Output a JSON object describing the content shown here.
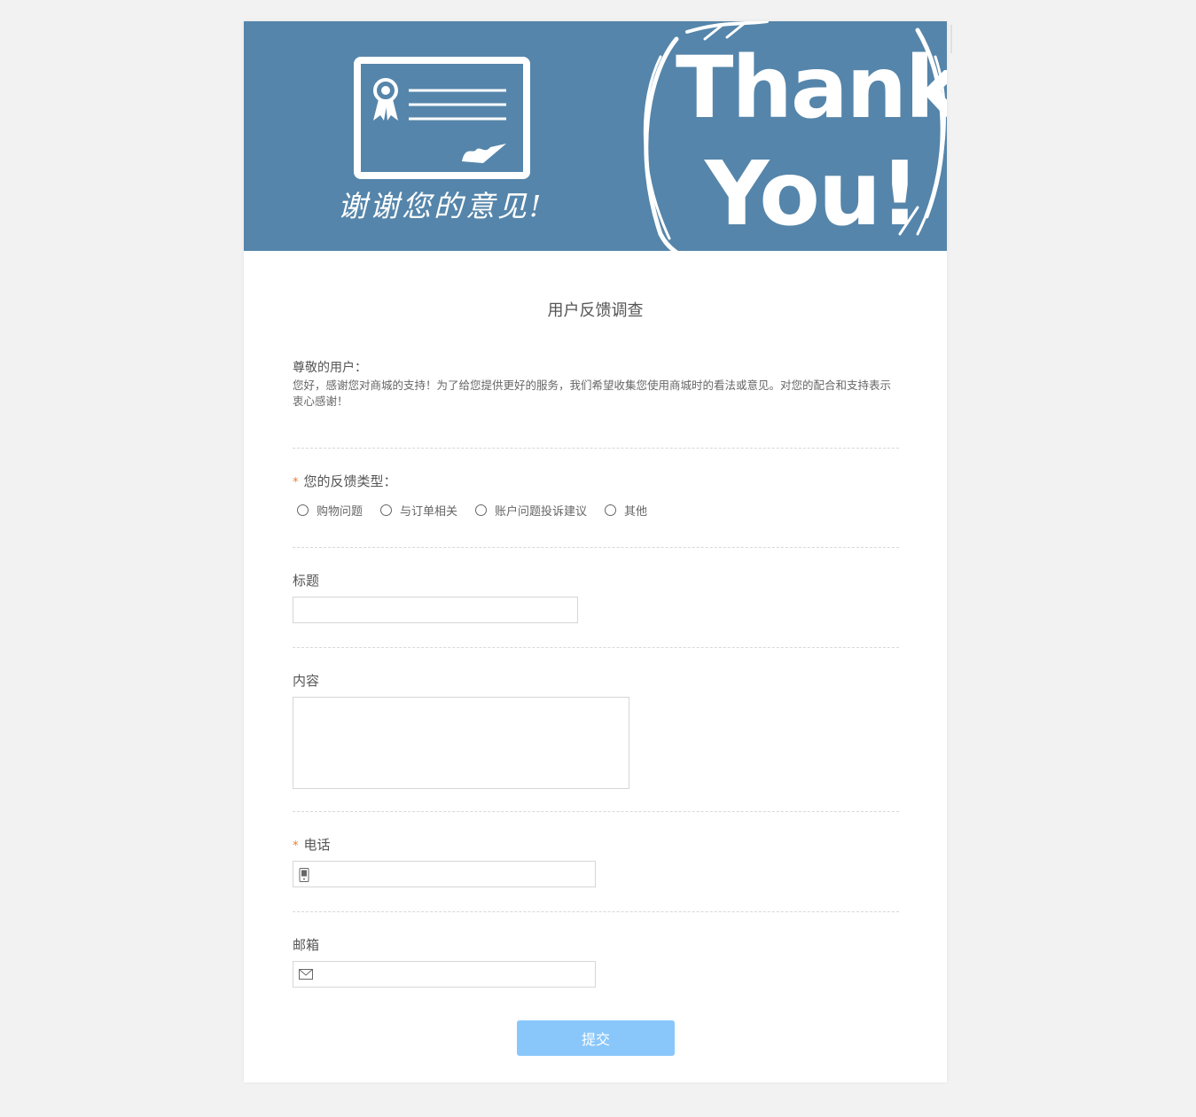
{
  "banner": {
    "caption": "谢谢您的意见!",
    "thank_line1": "Thank",
    "thank_line2": "You!"
  },
  "form": {
    "title": "用户反馈调查",
    "greeting": "尊敬的用户：",
    "intro": "您好，感谢您对商城的支持！为了给您提供更好的服务，我们希望收集您使用商城时的看法或意见。对您的配合和支持表示衷心感谢！",
    "feedback_type": {
      "required_mark": "*",
      "label": "您的反馈类型：",
      "options": [
        "购物问题",
        "与订单相关",
        "账户问题投诉建议",
        "其他"
      ]
    },
    "title_field": {
      "label": "标题",
      "value": ""
    },
    "content_field": {
      "label": "内容",
      "value": ""
    },
    "phone_field": {
      "required_mark": "*",
      "label": "电话",
      "icon": "phone-icon",
      "value": ""
    },
    "email_field": {
      "label": "邮箱",
      "icon": "mail-icon",
      "value": ""
    },
    "submit_label": "提交"
  },
  "colors": {
    "banner_bg": "#5585aa",
    "submit_bg": "#89c7fa",
    "required_mark": "#ee7d2d",
    "page_bg": "#f2f2f2"
  }
}
